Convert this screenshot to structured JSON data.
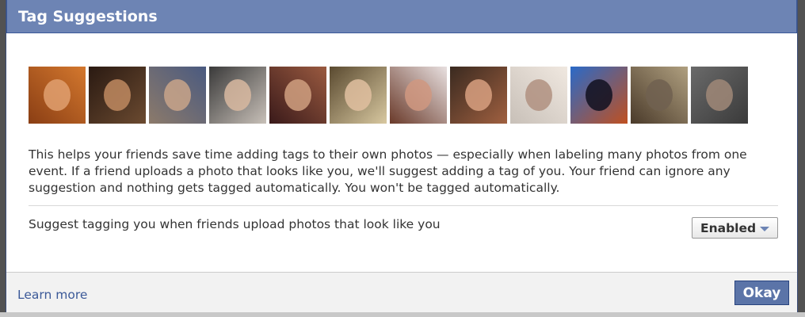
{
  "dialog": {
    "title": "Tag Suggestions",
    "description": "This helps your friends save time adding tags to their own photos — especially when labeling many photos from one event. If a friend uploads a photo that looks like you, we'll suggest adding a tag of you. Your friend can ignore any suggestion and nothing gets tagged automatically. You won't be tagged automatically.",
    "setting_label": "Suggest tagging you when friends upload photos that look like you",
    "setting_value": "Enabled",
    "learn_more": "Learn more",
    "okay": "Okay"
  },
  "photos": [
    {
      "bg": "#8a3e14",
      "bg2": "#d4782e",
      "face": "#e0a070"
    },
    {
      "bg": "#2a1a12",
      "bg2": "#6b4a30",
      "face": "#c08a60"
    },
    {
      "bg": "#8c7a6a",
      "bg2": "#4a5a80",
      "face": "#c9a58a"
    },
    {
      "bg": "#3a3a3a",
      "bg2": "#c8c0b8",
      "face": "#d8b8a0"
    },
    {
      "bg": "#3a1a1a",
      "bg2": "#9a5a40",
      "face": "#d0a080"
    },
    {
      "bg": "#5a4a30",
      "bg2": "#d8c8a0",
      "face": "#e0c0a0"
    },
    {
      "bg": "#6a3a2a",
      "bg2": "#e8e0e0",
      "face": "#d09880"
    },
    {
      "bg": "#3a2a20",
      "bg2": "#a06040",
      "face": "#d8a080"
    },
    {
      "bg": "#c8c0b8",
      "bg2": "#f0e8e0",
      "face": "#b09080"
    },
    {
      "bg": "#2a6ac8",
      "bg2": "#c05020",
      "face": "#101020"
    },
    {
      "bg": "#4a3a2a",
      "bg2": "#b0a080",
      "face": "#706050"
    },
    {
      "bg": "#6a6a6a",
      "bg2": "#3a3a3a",
      "face": "#a08878"
    }
  ],
  "colors": {
    "titlebar": "#6d84b4",
    "link": "#3b5998",
    "button": "#5b74a8"
  }
}
